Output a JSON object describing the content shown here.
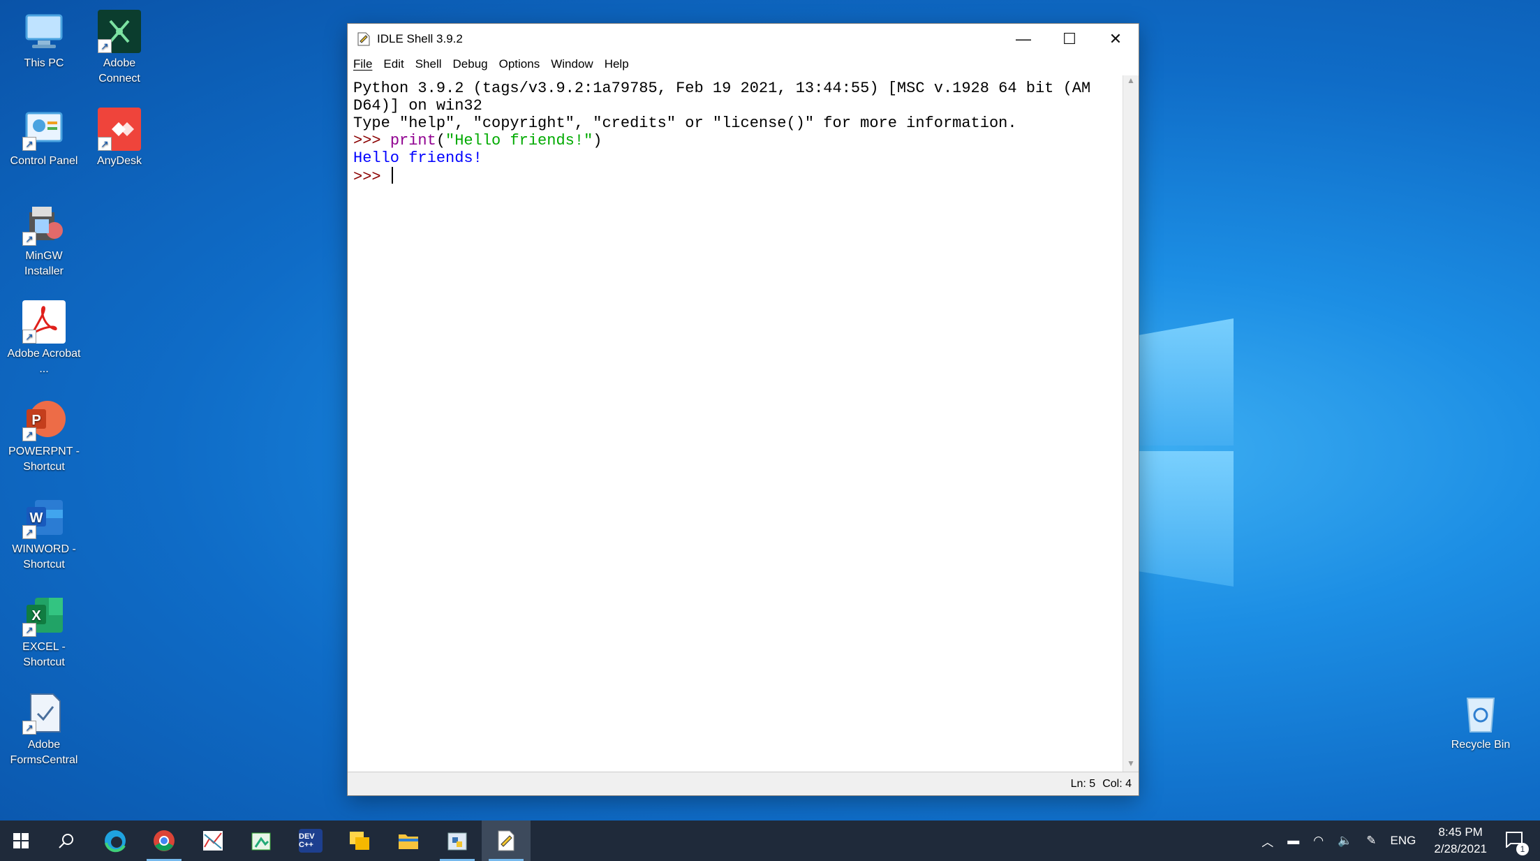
{
  "desktop": {
    "icons": [
      {
        "label": "This PC",
        "icon": "this-pc-icon"
      },
      {
        "label": "Adobe Connect",
        "icon": "adobe-connect-icon"
      },
      {
        "label": "Control Panel",
        "icon": "control-panel-icon"
      },
      {
        "label": "AnyDesk",
        "icon": "anydesk-icon"
      },
      {
        "label": "MinGW Installer",
        "icon": "mingw-installer-icon"
      },
      {
        "label": "Adobe Acrobat ...",
        "icon": "adobe-acrobat-icon"
      },
      {
        "label": "POWERPNT - Shortcut",
        "icon": "powerpoint-icon"
      },
      {
        "label": "WINWORD - Shortcut",
        "icon": "word-icon"
      },
      {
        "label": "EXCEL - Shortcut",
        "icon": "excel-icon"
      },
      {
        "label": "Adobe FormsCentral",
        "icon": "adobe-formscentral-icon"
      },
      {
        "label": "Recycle Bin",
        "icon": "recycle-bin-icon"
      }
    ]
  },
  "window": {
    "title": "IDLE Shell 3.9.2",
    "menu": [
      "File",
      "Edit",
      "Shell",
      "Debug",
      "Options",
      "Window",
      "Help"
    ],
    "shell": {
      "line1": "Python 3.9.2 (tags/v3.9.2:1a79785, Feb 19 2021, 13:44:55) [MSC v.1928 64 bit (AM",
      "line2": "D64)] on win32",
      "line3": "Type \"help\", \"copyright\", \"credits\" or \"license()\" for more information.",
      "prompt": ">>> ",
      "cmd_builtin": "print",
      "cmd_open": "(",
      "cmd_string": "\"Hello friends!\"",
      "cmd_close": ")",
      "output": "Hello friends!"
    },
    "status": {
      "line": "Ln: 5",
      "col": "Col: 4"
    }
  },
  "taskbar": {
    "items": [
      {
        "name": "start-button",
        "icon": "windows-icon"
      },
      {
        "name": "search-button",
        "icon": "search-icon"
      },
      {
        "name": "edge",
        "icon": "edge-icon"
      },
      {
        "name": "chrome",
        "icon": "chrome-icon"
      },
      {
        "name": "app-chart",
        "icon": "chart-app-icon"
      },
      {
        "name": "app-paint",
        "icon": "paint-app-icon"
      },
      {
        "name": "devcpp",
        "icon": "devcpp-icon",
        "label": "DEV C++"
      },
      {
        "name": "sticky",
        "icon": "folders-icon"
      },
      {
        "name": "file-explorer",
        "icon": "file-explorer-icon"
      },
      {
        "name": "python-launcher",
        "icon": "python-icon"
      },
      {
        "name": "idle",
        "icon": "idle-icon"
      }
    ],
    "tray": {
      "lang": "ENG",
      "time": "8:45 PM",
      "date": "2/28/2021",
      "notifications": "1"
    }
  },
  "colors": {
    "prompt": "#8b0000",
    "builtin": "#900090",
    "string": "#00aa00",
    "output": "#0000ff"
  }
}
